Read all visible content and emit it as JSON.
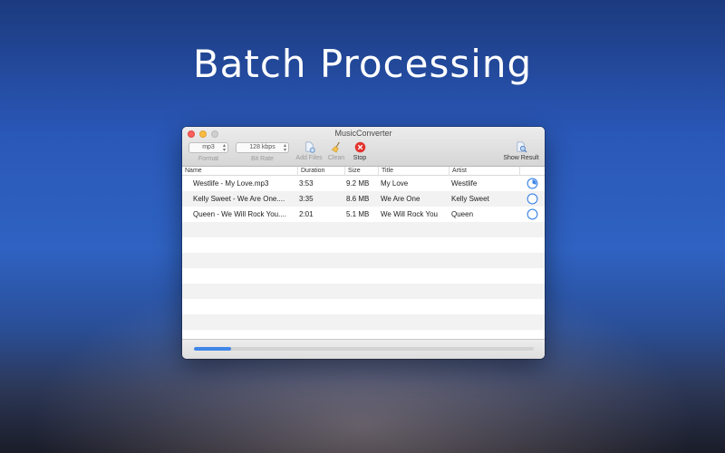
{
  "headline": "Batch Processing",
  "window": {
    "title": "MusicConverter",
    "format": {
      "value": "mp3",
      "label": "Format"
    },
    "bitrate": {
      "value": "128 kbps",
      "label": "Bit Rate"
    },
    "toolbar": {
      "add_files": "Add Files",
      "clean": "Clean",
      "stop": "Stop",
      "show_result": "Show Result"
    },
    "columns": [
      "Name",
      "Duration",
      "Size",
      "Title",
      "Artist"
    ],
    "files": [
      {
        "name": "Westlife - My Love.mp3",
        "duration": "3:53",
        "size": "9.2 MB",
        "title": "My Love",
        "artist": "Westlife",
        "progress": 0.3
      },
      {
        "name": "Kelly Sweet - We Are One....",
        "duration": "3:35",
        "size": "8.6 MB",
        "title": "We Are One",
        "artist": "Kelly Sweet",
        "progress": 0
      },
      {
        "name": "Queen - We Will Rock You....",
        "duration": "2:01",
        "size": "5.1 MB",
        "title": "We Will Rock You",
        "artist": "Queen",
        "progress": 0
      }
    ],
    "overall_progress": 0.11,
    "colors": {
      "accent": "#3f86e8",
      "stop": "#e3342f"
    }
  }
}
